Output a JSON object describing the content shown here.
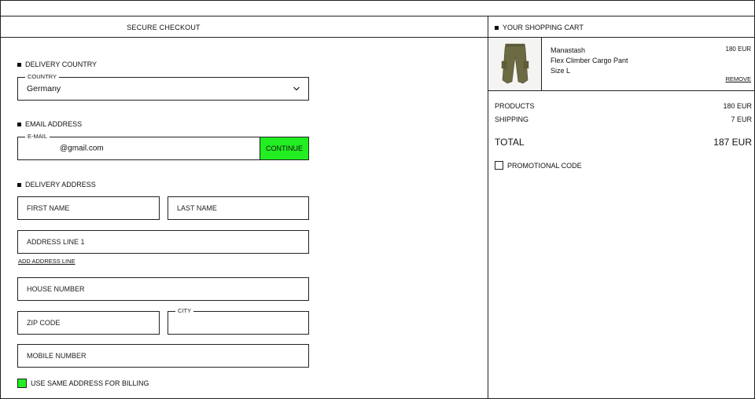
{
  "checkout": {
    "title": "SECURE CHECKOUT",
    "delivery_country": {
      "section_title": "DELIVERY COUNTRY",
      "legend": "COUNTRY",
      "value": "Germany"
    },
    "email": {
      "section_title": "EMAIL ADDRESS",
      "legend": "E-MAIL",
      "value": "@gmail.com",
      "continue_label": "CONTINUE"
    },
    "delivery_address": {
      "section_title": "DELIVERY ADDRESS",
      "first_name": "FIRST NAME",
      "last_name": "LAST NAME",
      "address_line_1": "ADDRESS LINE 1",
      "add_address_line": "ADD ADDRESS LINE",
      "house_number": "HOUSE NUMBER",
      "zip_code": "ZIP CODE",
      "city_legend": "CITY",
      "mobile_number": "MOBILE NUMBER"
    },
    "billing_checkbox_label": "USE SAME ADDRESS FOR BILLING"
  },
  "cart": {
    "title": "YOUR SHOPPING CART",
    "item": {
      "brand": "Manastash",
      "name": "Flex Climber Cargo Pant",
      "size": "Size L",
      "price": "180 EUR",
      "remove_label": "REMOVE",
      "thumbnail_icon": "cargo-pants-image"
    },
    "summary": {
      "products_label": "PRODUCTS",
      "products_value": "180 EUR",
      "shipping_label": "SHIPPING",
      "shipping_value": "7 EUR",
      "total_label": "TOTAL",
      "total_value": "187 EUR"
    },
    "promo_label": "PROMOTIONAL CODE"
  },
  "colors": {
    "accent": "#22ee22",
    "border": "#222222",
    "pants": "#6b6a42"
  }
}
